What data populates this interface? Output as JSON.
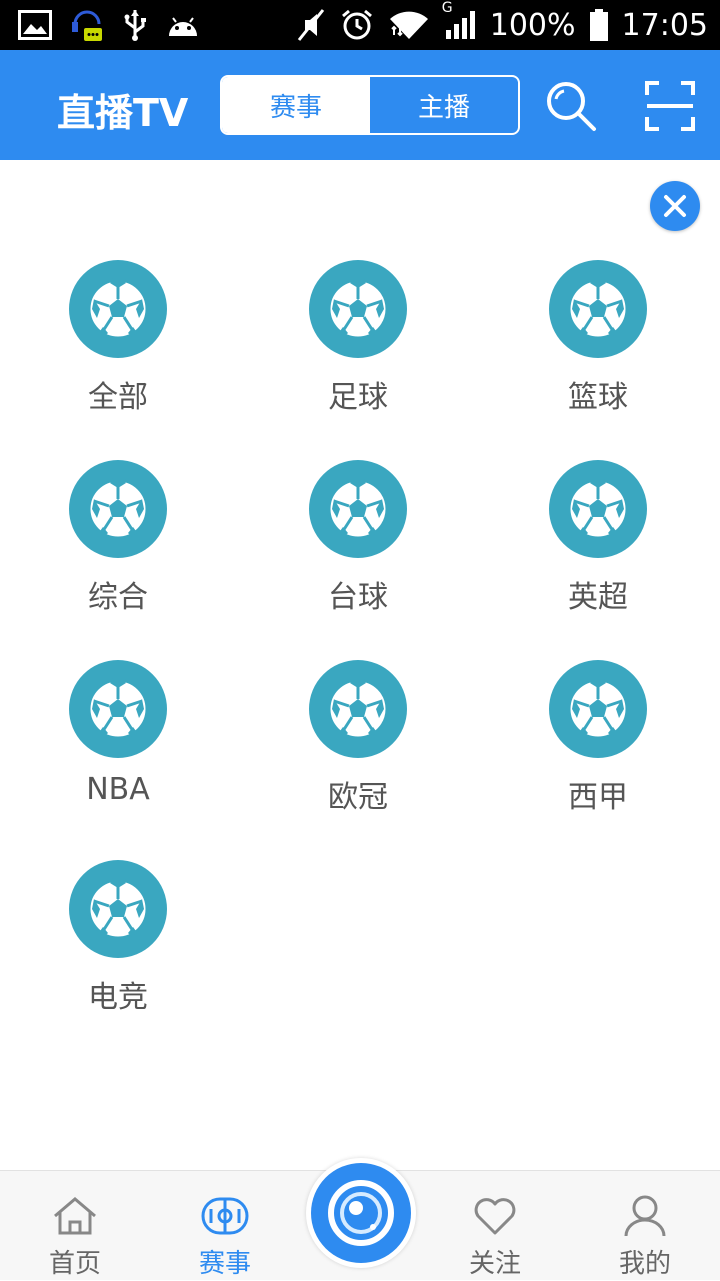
{
  "status_bar": {
    "battery": "100%",
    "time": "17:05",
    "network_type": "G",
    "icons": [
      "image-icon",
      "chat-icon",
      "usb-icon",
      "android-icon",
      "mute-icon",
      "alarm-icon",
      "wifi-icon",
      "signal-icon",
      "battery-icon"
    ]
  },
  "header": {
    "title": "直播TV",
    "tabs": [
      {
        "label": "赛事",
        "active": true
      },
      {
        "label": "主播",
        "active": false
      }
    ],
    "icons": [
      "search-icon",
      "scan-icon"
    ]
  },
  "close_icon": "close-icon",
  "categories": [
    {
      "label": "全部",
      "icon": "soccer-ball-icon"
    },
    {
      "label": "足球",
      "icon": "soccer-ball-icon"
    },
    {
      "label": "篮球",
      "icon": "soccer-ball-icon"
    },
    {
      "label": "综合",
      "icon": "soccer-ball-icon"
    },
    {
      "label": "台球",
      "icon": "soccer-ball-icon"
    },
    {
      "label": "英超",
      "icon": "soccer-ball-icon"
    },
    {
      "label": "NBA",
      "icon": "soccer-ball-icon"
    },
    {
      "label": "欧冠",
      "icon": "soccer-ball-icon"
    },
    {
      "label": "西甲",
      "icon": "soccer-ball-icon"
    },
    {
      "label": "电竞",
      "icon": "soccer-ball-icon"
    }
  ],
  "tab_bar": {
    "items": [
      {
        "label": "首页",
        "icon": "home-icon",
        "active": false
      },
      {
        "label": "赛事",
        "icon": "match-icon",
        "active": true
      },
      {
        "label": "关注",
        "icon": "heart-icon",
        "active": false
      },
      {
        "label": "我的",
        "icon": "profile-icon",
        "active": false
      }
    ],
    "center_icon": "live-camera-icon"
  },
  "colors": {
    "primary": "#2e8bf0",
    "category_icon": "#3aa7c0",
    "label": "#555555",
    "tab_inactive": "#666666"
  }
}
